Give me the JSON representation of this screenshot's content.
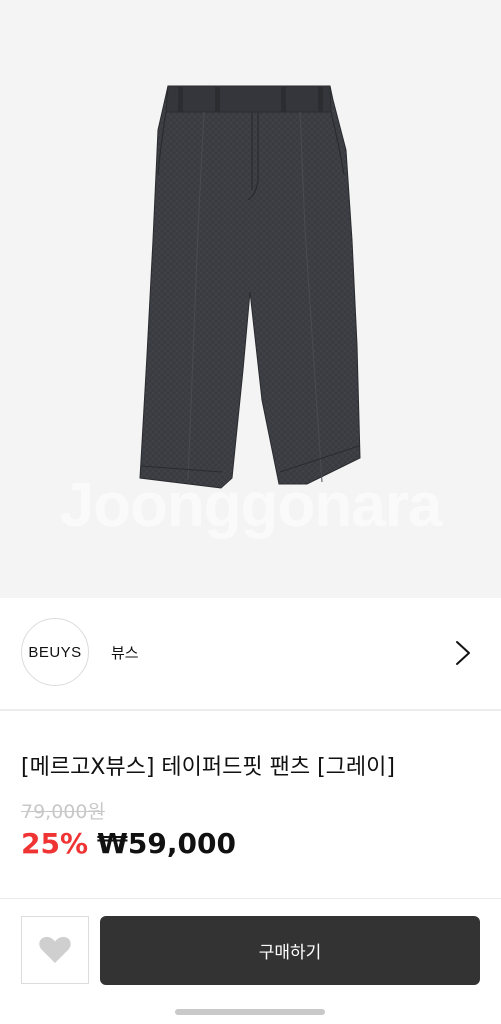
{
  "product_image": {
    "alt": "pants-photo",
    "watermark": "Joonggonara"
  },
  "seller": {
    "logo_text": "BEUYS",
    "name": "뷰스",
    "arrow_icon": "chevron-right-icon"
  },
  "product": {
    "title": "[메르고X뷰스] 테이퍼드핏 팬츠 [그레이]",
    "original_price": "79,000원",
    "discount": "25%",
    "price": "₩59,000"
  },
  "actions": {
    "like_icon": "heart-icon",
    "buy_label": "구매하기"
  },
  "colors": {
    "discount": "#f03333",
    "buy_button": "#333333",
    "hero_bg": "#f4f4f4"
  }
}
